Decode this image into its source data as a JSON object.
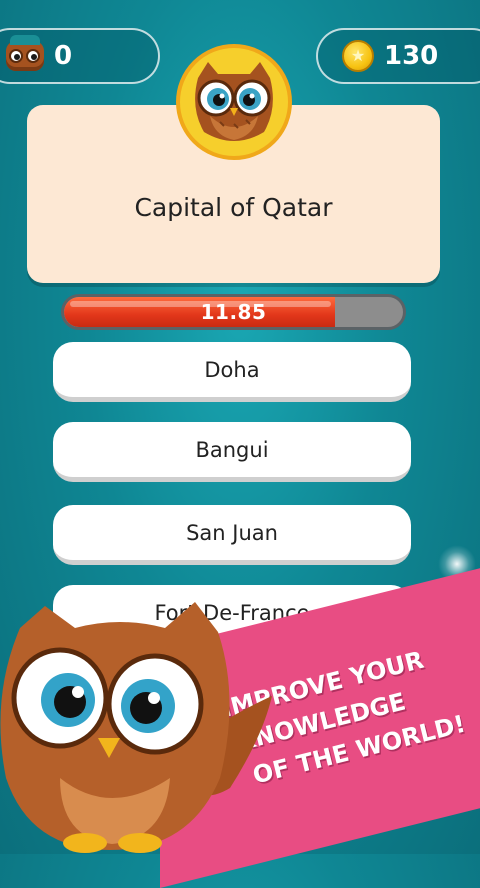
{
  "topbar": {
    "score": "0",
    "coins": "130"
  },
  "question": {
    "text": "Capital of Qatar"
  },
  "timer": {
    "value": "11.85",
    "fraction": 0.8
  },
  "answers": [
    "Doha",
    "Bangui",
    "San Juan",
    "Fort-De-France"
  ],
  "promo": {
    "line1": "IMPROVE YOUR",
    "line2": "KNOWLEDGE",
    "line3": "OF THE WORLD!"
  },
  "colors": {
    "accent": "#e84d83",
    "timer": "#e2371a",
    "card": "#fde8d4"
  },
  "icons": [
    "owl-icon",
    "coin-icon",
    "star-icon"
  ]
}
